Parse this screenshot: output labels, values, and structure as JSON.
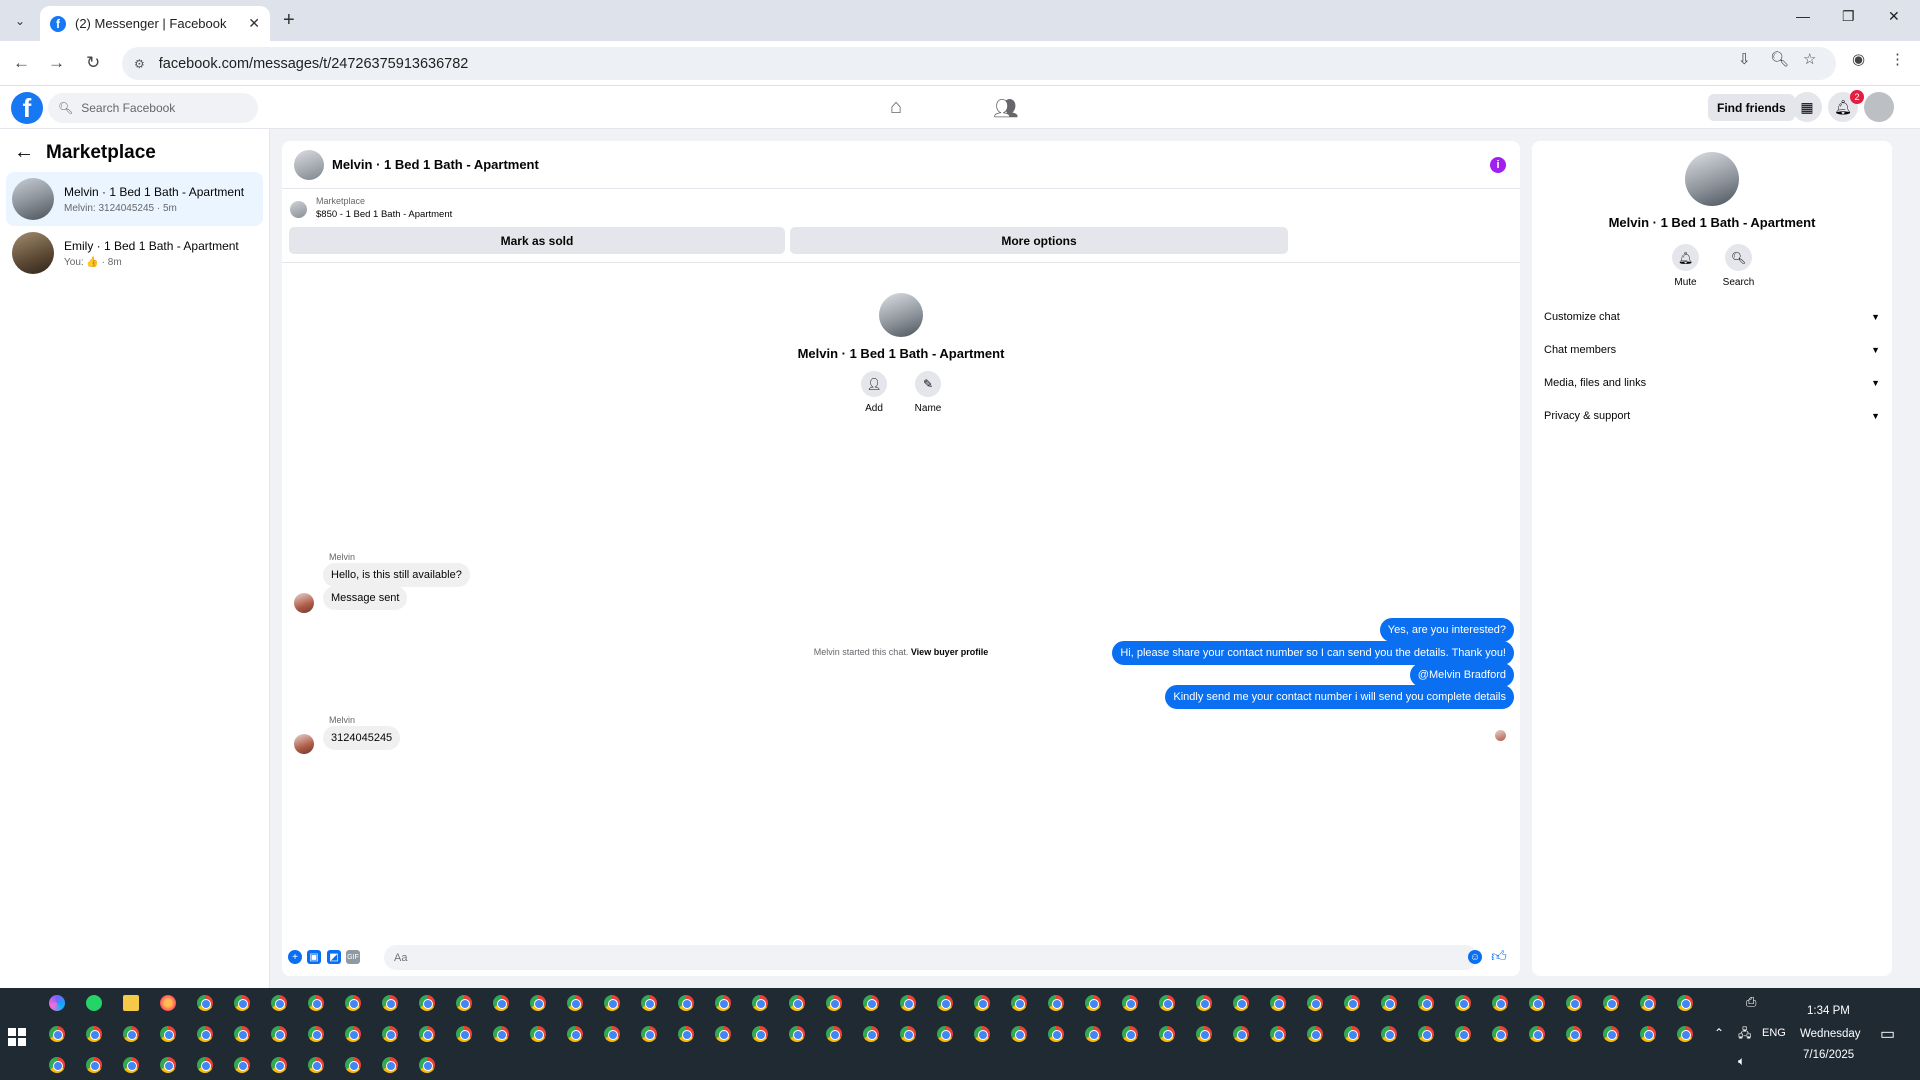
{
  "browser": {
    "tab_title": "(2) Messenger | Facebook",
    "tab_favicon": "f",
    "url": "facebook.com/messages/t/24726375913636782"
  },
  "fb": {
    "search_placeholder": "Search Facebook",
    "find_friends": "Find friends",
    "notification_count": "2"
  },
  "sidebar": {
    "title": "Marketplace",
    "conversations": [
      {
        "name": "Melvin · 1 Bed 1 Bath - Apartment",
        "preview": "Melvin: 3124045245 · 5m"
      },
      {
        "name": "Emily · 1 Bed 1 Bath - Apartment",
        "preview": "You: 👍 · 8m"
      }
    ]
  },
  "chat": {
    "title": "Melvin · 1 Bed 1 Bath - Apartment",
    "listing_source": "Marketplace",
    "listing_detail": "$850 - 1 Bed 1 Bath - Apartment",
    "mark_sold": "Mark as sold",
    "more_options": "More options",
    "intro_name": "Melvin · 1 Bed 1 Bath - Apartment",
    "intro_add": "Add",
    "intro_name_action": "Name",
    "started_text": "Melvin started this chat.",
    "view_profile": "View buyer profile",
    "messages_in_1": {
      "sender": "Melvin",
      "msg1": "Hello, is this still available?",
      "msg2": "Message sent"
    },
    "messages_out": [
      "Yes, are you interested?",
      "Hi, please share your contact number so I can send you the details. Thank you!",
      "@Melvin Bradford",
      "Kindly send me your contact number i will send you complete details"
    ],
    "messages_in_2": {
      "sender": "Melvin",
      "msg": "3124045245"
    },
    "composer_placeholder": "Aa"
  },
  "details": {
    "name": "Melvin · 1 Bed 1 Bath - Apartment",
    "mute": "Mute",
    "search": "Search",
    "sections": [
      "Customize chat",
      "Chat members",
      "Media, files and links",
      "Privacy & support"
    ]
  },
  "taskbar": {
    "time": "1:34 PM",
    "day": "Wednesday",
    "date": "7/16/2025",
    "lang": "ENG"
  },
  "colors": {
    "accent": "#1877f2",
    "bubble_out": "#0a6ff0",
    "info": "#a020f0",
    "badge": "#e41e3f"
  }
}
